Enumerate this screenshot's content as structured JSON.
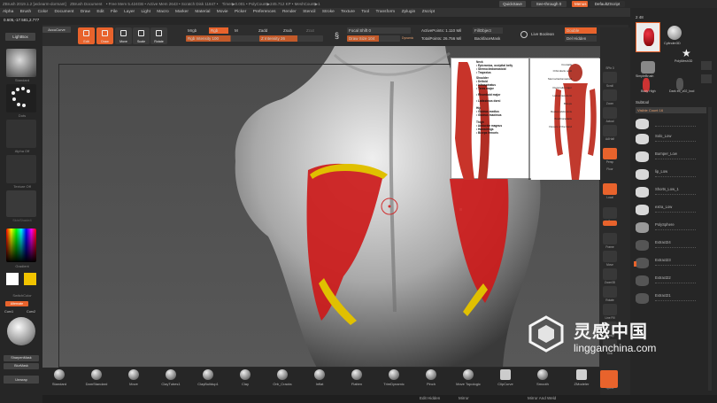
{
  "titlebar": {
    "items": [
      "ZBrush 2019.1.2 [wclearm-dormant]",
      "ZBrush Document",
      "• Free Mem 5.424GB • Active Mem 2643 • Scratch Disk 11847 •",
      "Timer▶0.001 • PolyCount▶245.712 KP • MeshCount▶1"
    ],
    "quicksave": "QuickSave",
    "seethrough": "See-through  0",
    "menus": "Menus",
    "default_zscript": "DefaultZScript"
  },
  "menubar": [
    "Alpha",
    "Brush",
    "Color",
    "Document",
    "Draw",
    "Edit",
    "File",
    "Layer",
    "Light",
    "Macro",
    "Marker",
    "Material",
    "Movie",
    "Picker",
    "Preferences",
    "Render",
    "Stencil",
    "Stroke",
    "Texture",
    "Tool",
    "Transform",
    "Zplugin",
    "Zscript"
  ],
  "coords": "0.605,-17.581,2.777",
  "left": {
    "lightbox": "LightBox",
    "accucurve": "AccuCurve",
    "standard": "Standard",
    "dots": "Dots",
    "alpha_off": "Alpha Off",
    "texture_off": "Texture Off",
    "material": "SkinShade4",
    "gradient": "Gradient",
    "switchcolor": "SwitchColor",
    "alternate": "Alternate",
    "curv1": "Curv1",
    "curv2": "Curv2",
    "sharpenmask": "SharpenMask",
    "blurmask": "BlurMask",
    "unwrap": "Unwrap"
  },
  "toolbar": {
    "edit": "Edit",
    "draw": "Draw",
    "move": "Move",
    "scale": "Scale",
    "rotate": "Rotate",
    "mrgb": "Mrgb",
    "rgb": "Rgb",
    "m": "M",
    "zadd": "Zadd",
    "zsub": "Zsub",
    "zcut": "Zcut",
    "rgb_intensity": "Rgb Intensity 100",
    "z_intensity": "Z Intensity 26",
    "focal_shift": "Focal Shift 0",
    "draw_size": "Draw Size 104",
    "dynamic": "Dynamic",
    "active_points": "ActivePoints: 1.110 Mil",
    "total_points": "TotalPoints: 26.756 Mil",
    "fill_object": "FillObject",
    "backface_mask": "BackfaceMask",
    "live_boolean": "Live Boolean",
    "double": "Double",
    "grp": "Grp",
    "del_hidden": "Del Hidden",
    "tri": "Tri"
  },
  "rightshelf": [
    "SPix 3",
    "Scroll",
    "Zoom",
    "Actual",
    "AAHalf",
    "Persp",
    "Floor",
    "Local",
    "L.Sym",
    "Frame",
    "Move",
    "Zoom3D",
    "Rotate",
    "Line Fill",
    "Transp",
    "Solo",
    "Xpose"
  ],
  "toolpanel": {
    "count_label": "2  48",
    "tool_names": [
      "Cylinder3D",
      "PolyMesh3D",
      "SimpleBrush",
      "Body High",
      "Dark eb_v02_bod"
    ],
    "subtool_header": "Subtool",
    "visible_count": "Visible Count 16",
    "subtools": [
      "Solo_Low",
      "Burnper_Low",
      "lip_Low",
      "Shorts_Low_1",
      "extra_Low",
      "PolySphere",
      "Extract24",
      "Extract23",
      "Extract22",
      "Extract21"
    ]
  },
  "brushes": [
    "Standard",
    "DamStandard",
    "Move",
    "ClayTubes1",
    "ClayBuildup1",
    "Clay",
    "Orb_Cracks",
    "Inflat",
    "Flatten",
    "TrimDynamic",
    "Pinch",
    "Move Topologic",
    "ClipCurve",
    "Smooth"
  ],
  "zmodeler": "ZModeler",
  "bottombar": {
    "mirror": "Mirror",
    "mirror_weld": "Mirror And Weld",
    "edit_hidden": "Edit Hidden"
  },
  "reference": {
    "back_labels": [
      "Neck",
      "• Epicranius, occipital belly",
      "• Sternocleidomastoid",
      "• Trapezius",
      "Shoulder",
      "• Deltoid",
      "• Infraspinatus",
      "• Teres major",
      "• Rhomboid major",
      "• Latissimus dorsi",
      "Hip",
      "• Gluteus medius",
      "• Gluteus maximus",
      "Thigh",
      "• Adductor magnus",
      "• Hamstrings",
      "• Biceps femoris"
    ],
    "front_labels": [
      "Frontalis",
      "Orbicularis oculi",
      "Sternocleidomastoid",
      "Pectoralis major",
      "Latissimus dorsi",
      "Biceps",
      "Rectus abdominis",
      "Brachioradialis",
      "Flexors of the hand"
    ]
  },
  "watermark": {
    "cn": "灵感中国",
    "url": "lingganchina.com"
  },
  "colors": {
    "accent": "#e8632c",
    "muscle_red": "#cc1a1a",
    "tendon_yellow": "#e0c000"
  }
}
